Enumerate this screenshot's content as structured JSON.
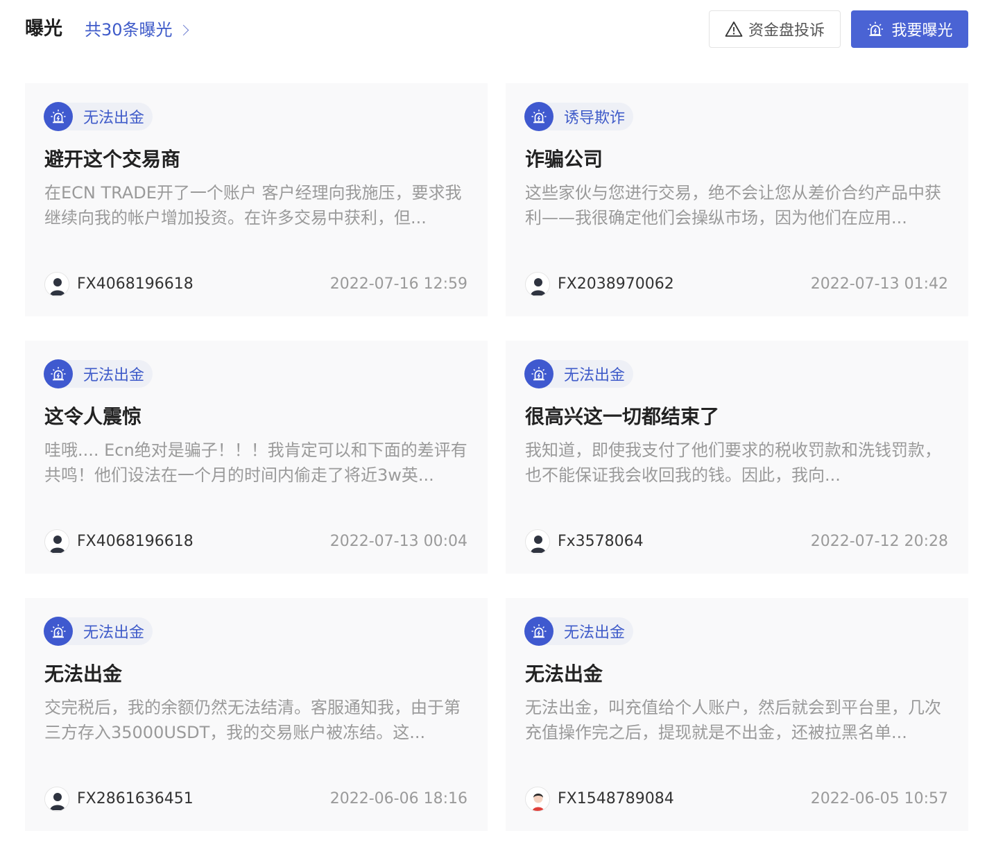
{
  "header": {
    "title": "曝光",
    "count_link": "共30条曝光",
    "complaint_button": "资金盘投诉",
    "expose_button": "我要曝光"
  },
  "cards": [
    {
      "tag": "无法出金",
      "title": "避开这个交易商",
      "desc": "在ECN TRADE开了一个账户 客户经理向我施压，要求我继续向我的帐户增加投资。在许多交易中获利，但...",
      "user": "FX4068196618",
      "date": "2022-07-16 12:59",
      "avatar": "dark"
    },
    {
      "tag": "诱导欺诈",
      "title": "诈骗公司",
      "desc": "这些家伙与您进行交易，绝不会让您从差价合约产品中获利——我很确定他们会操纵市场，因为他们在应用...",
      "user": "FX2038970062",
      "date": "2022-07-13 01:42",
      "avatar": "dark"
    },
    {
      "tag": "无法出金",
      "title": "这令人震惊",
      "desc": "哇哦.... Ecn绝对是骗子！！！我肯定可以和下面的差评有共鸣！他们设法在一个月的时间内偷走了将近3w英...",
      "user": "FX4068196618",
      "date": "2022-07-13 00:04",
      "avatar": "dark"
    },
    {
      "tag": "无法出金",
      "title": "很高兴这一切都结束了",
      "desc": "我知道，即使我支付了他们要求的税收罚款和洗钱罚款，也不能保证我会收回我的钱。因此，我向...",
      "user": "Fx3578064",
      "date": "2022-07-12 20:28",
      "avatar": "dark"
    },
    {
      "tag": "无法出金",
      "title": "无法出金",
      "desc": "交完税后，我的余额仍然无法结清。客服通知我，由于第三方存入35000USDT，我的交易账户被冻结。这...",
      "user": "FX2861636451",
      "date": "2022-06-06 18:16",
      "avatar": "dark"
    },
    {
      "tag": "无法出金",
      "title": "无法出金",
      "desc": "无法出金，叫充值给个人账户，然后就会到平台里，几次充值操作完之后，提现就是不出金，还被拉黑名单...",
      "user": "FX1548789084",
      "date": "2022-06-05 10:57",
      "avatar": "red"
    }
  ],
  "colors": {
    "accent": "#4a63d4",
    "tag_text": "#3f5bc9",
    "card_bg": "#f9f9fa"
  }
}
